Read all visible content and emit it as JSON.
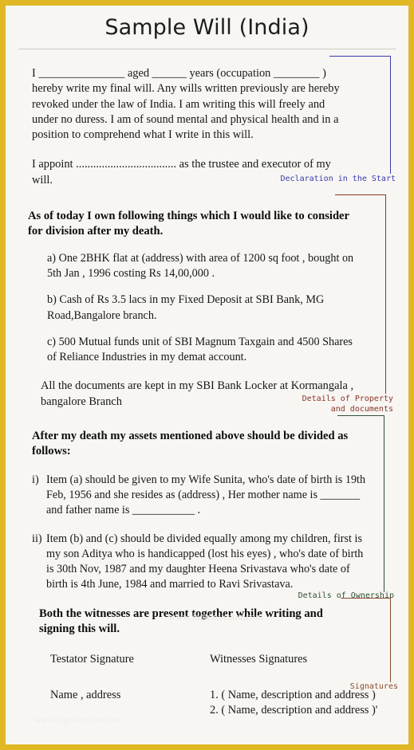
{
  "document": {
    "title": "Sample Will (India)",
    "watermark_primary": "www.jagoinvestor.com",
    "watermark_secondary": "www.jagoinvestor.com"
  },
  "section_declaration": {
    "annotation": "Declaration in the Start",
    "annotation_color": "#3b3bad",
    "paragraph_1": "I _______________ aged ______ years (occupation ________  ) hereby write my final will. Any wills written previously are hereby revoked under the law of India. I am writing this will freely and under no duress. I am of sound mental and physical health and in a position to comprehend what I write in this will.",
    "paragraph_2": "I appoint ................................... as the trustee and executor of my will."
  },
  "section_property": {
    "annotation": "Details of Property\nand documents",
    "annotation_color": "#8b3228",
    "heading": "As of today I own following things which I would like to consider for division after my death.",
    "items": [
      "a) One 2BHK flat at (address) with area of 1200 sq foot , bought on 5th Jan , 1996 costing Rs 14,00,000 .",
      "b) Cash of Rs 3.5 lacs in my Fixed Deposit at SBI Bank, MG Road,Bangalore branch.",
      "c) 500 Mutual funds unit of SBI Magnum Taxgain and 4500 Shares of Reliance Industries in my demat account."
    ],
    "closing": "All the documents are kept in my SBI Bank Locker at Kormangala , bangalore Branch"
  },
  "section_ownership": {
    "annotation": "Details of Ownership",
    "annotation_color": "#2f5036",
    "heading": "After my death my assets mentioned above should be divided as follows:",
    "items": [
      {
        "marker": "i)",
        "text": "Item (a) should be given to my Wife Sunita, who's date of birth is 19th Feb, 1956 and she resides as (address) , Her mother name is _______ and father name is ___________ ."
      },
      {
        "marker": "ii)",
        "text": "Item (b) and (c) should be divided equally among my children, first is my son Aditya who is handicapped (lost his eyes) , who's date of  birth is 30th Nov, 1987 and my daughter Heena Srivastava who's date of birth is 4th June, 1984 and married to Ravi Srivastava."
      }
    ]
  },
  "section_signatures": {
    "annotation": "Signatures",
    "annotation_color": "#8b4b2a",
    "heading": "Both the witnesses are present together while writing and signing this will.",
    "testator_label": "Testator Signature",
    "witness_label": "Witnesses Signatures",
    "testator_value": "Name , address",
    "witness_values": [
      "1. ( Name, description and address )",
      "2. ( Name, description and address )'"
    ]
  }
}
